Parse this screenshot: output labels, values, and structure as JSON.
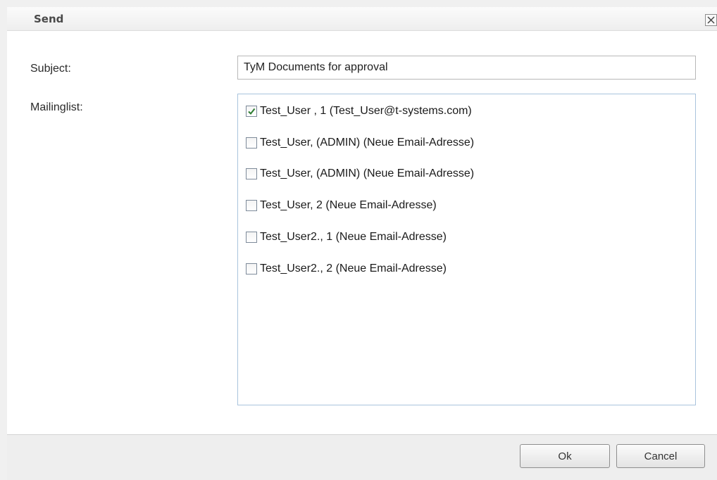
{
  "dialog": {
    "title": "Send",
    "close_label": "×"
  },
  "form": {
    "subject_label": "Subject:",
    "subject_value": "TyM Documents for approval",
    "mailinglist_label": "Mailinglist:"
  },
  "mailinglist": {
    "items": [
      {
        "label": "Test_User , 1 (Test_User@t-systems.com)",
        "checked": true
      },
      {
        "label": "Test_User, (ADMIN) (Neue Email-Adresse)",
        "checked": false
      },
      {
        "label": "Test_User, (ADMIN) (Neue Email-Adresse)",
        "checked": false
      },
      {
        "label": "Test_User, 2 (Neue Email-Adresse)",
        "checked": false
      },
      {
        "label": "Test_User2., 1 (Neue Email-Adresse)",
        "checked": false
      },
      {
        "label": "Test_User2., 2 (Neue Email-Adresse)",
        "checked": false
      }
    ]
  },
  "buttons": {
    "ok_label": "Ok",
    "cancel_label": "Cancel"
  },
  "colors": {
    "checkmark": "#2e7d32",
    "list_border": "#a9c3dd"
  }
}
